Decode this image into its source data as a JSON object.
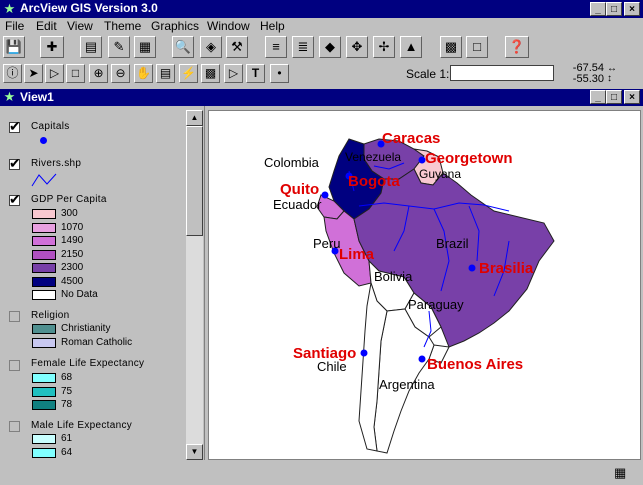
{
  "app": {
    "title": "ArcView GIS Version 3.0"
  },
  "menu": [
    "File",
    "Edit",
    "View",
    "Theme",
    "Graphics",
    "Window",
    "Help"
  ],
  "toolbar": {
    "scale_label": "Scale 1:",
    "scale_value": "",
    "coord_x": "-67.54",
    "coord_y": "-55.30"
  },
  "view": {
    "title": "View1"
  },
  "toc": {
    "capitals": {
      "name": "Capitals"
    },
    "rivers": {
      "name": "Rivers.shp"
    },
    "gdp": {
      "name": "GDP Per Capita",
      "classes": [
        {
          "label": "300",
          "color": "#f8c8d0"
        },
        {
          "label": "1070",
          "color": "#e8a0e0"
        },
        {
          "label": "1490",
          "color": "#d070d8"
        },
        {
          "label": "2150",
          "color": "#b050c0"
        },
        {
          "label": "2300",
          "color": "#7840a8"
        },
        {
          "label": "4500",
          "color": "#000080"
        },
        {
          "label": "No Data",
          "color": "#ffffff"
        }
      ]
    },
    "religion": {
      "name": "Religion",
      "classes": [
        {
          "label": "Christianity",
          "color": "#4f8f8f"
        },
        {
          "label": "Roman Catholic",
          "color": "#c8c8f0"
        }
      ]
    },
    "female": {
      "name": "Female Life Expectancy",
      "classes": [
        {
          "label": "68",
          "color": "#80ffff"
        },
        {
          "label": "75",
          "color": "#20c0c0"
        },
        {
          "label": "78",
          "color": "#108080"
        }
      ]
    },
    "male": {
      "name": "Male Life Expectancy",
      "classes": [
        {
          "label": "61",
          "color": "#c8ffff"
        },
        {
          "label": "64",
          "color": "#80ffff"
        }
      ]
    }
  },
  "map": {
    "countries": [
      "Colombia",
      "Venezuela",
      "Guyana",
      "Ecuador",
      "Peru",
      "Brazil",
      "Bolivia",
      "Paraguay",
      "Chile",
      "Argentina"
    ],
    "capitals": [
      "Caracas",
      "Georgetown",
      "Bogota",
      "Quito",
      "Lima",
      "Brasilia",
      "Santiago",
      "Buenos Aires"
    ]
  }
}
